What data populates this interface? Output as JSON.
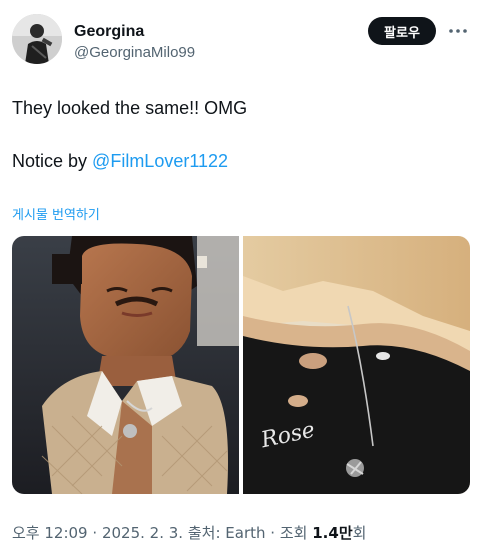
{
  "author": {
    "display_name": "Georgina",
    "handle": "@GeorginaMilo99"
  },
  "follow_label": "팔로우",
  "tweet": {
    "line1": "They looked the same!! OMG",
    "line2_prefix": "Notice by ",
    "mention": "@FilmLover1122"
  },
  "translate_label": "게시물 번역하기",
  "media": {
    "photo_left": "man-in-gucci-jacket",
    "photo_right": "woman-in-black-top",
    "necklace_text": "Rose"
  },
  "meta": {
    "time": "오후 12:09",
    "date": "2025. 2. 3.",
    "source_label": "출처:",
    "source": "Earth",
    "views_label": "조회",
    "views_count": "1.4만",
    "views_suffix": "회"
  },
  "colors": {
    "link": "#1d9bf0",
    "secondary_text": "#536471",
    "primary_text": "#0f1419",
    "button_bg": "#0f1419"
  }
}
